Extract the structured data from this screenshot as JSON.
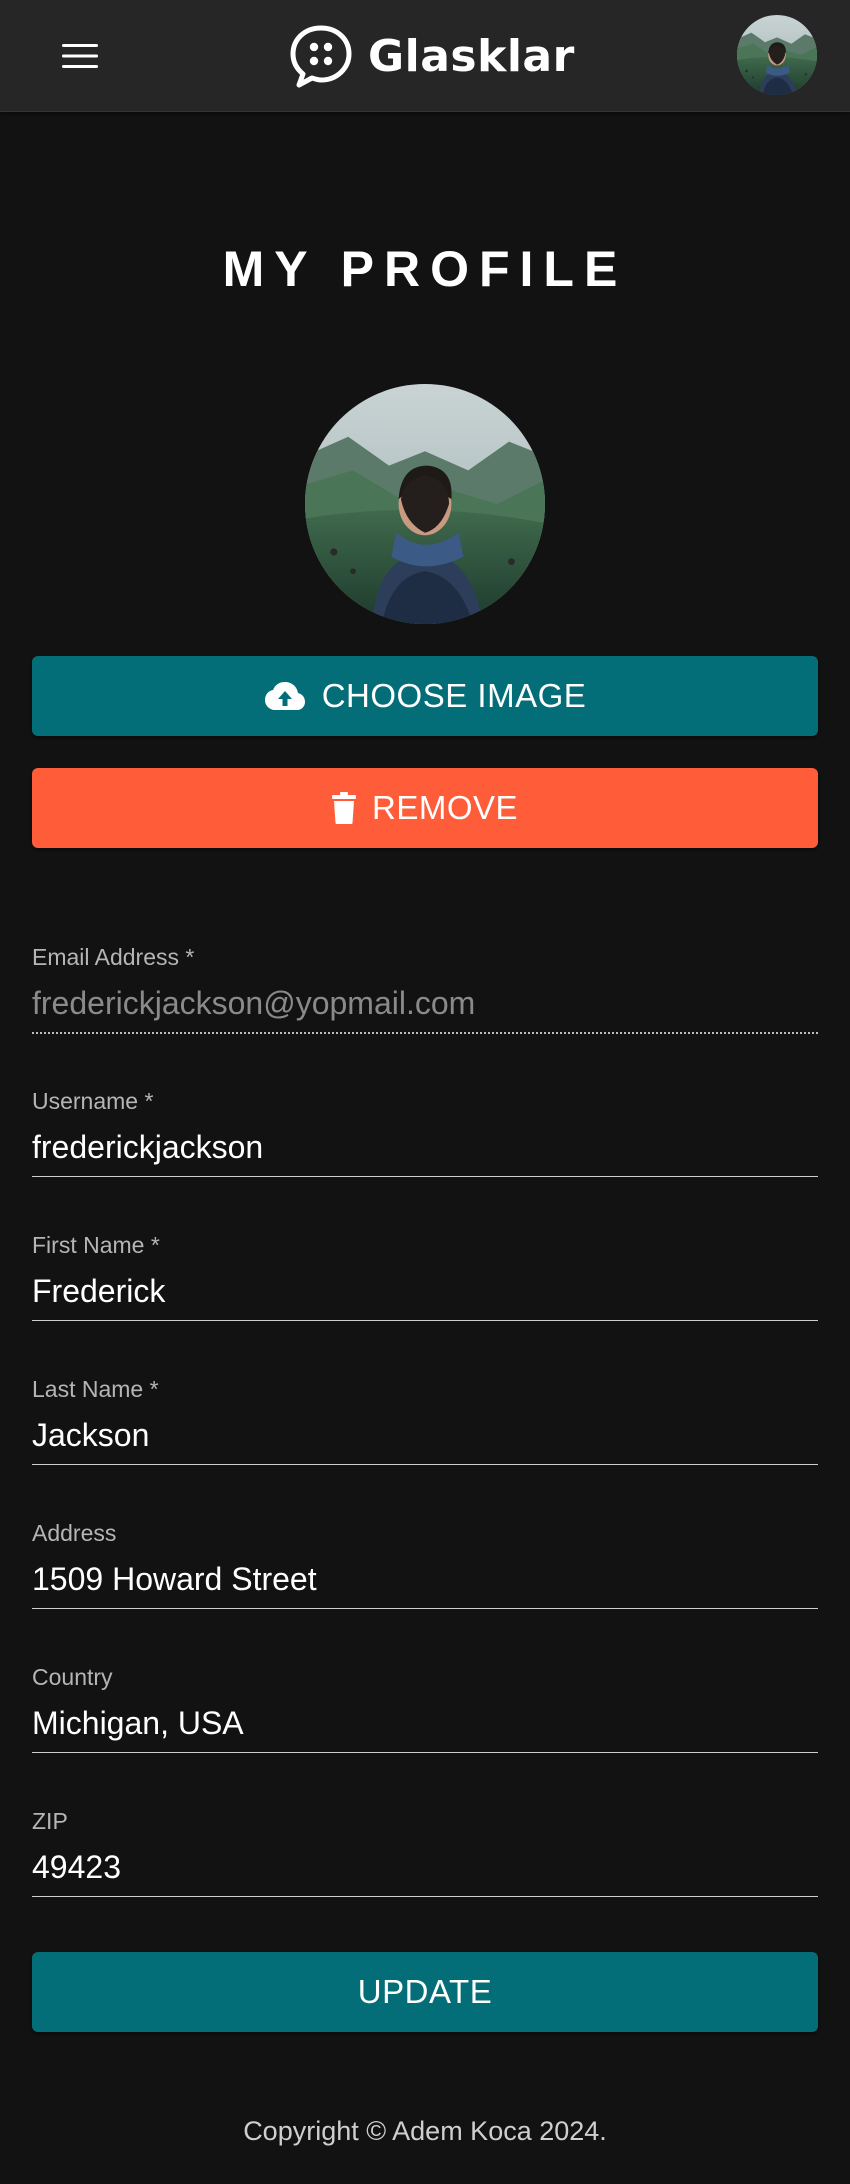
{
  "header": {
    "brand": "Glasklar",
    "menu_icon": "hamburger-menu-icon",
    "logo_icon": "chat-bubble-logo-icon",
    "avatar": "user-avatar-photo"
  },
  "profile": {
    "title": "MY PROFILE",
    "photo": "profile-photo-man-in-green-valley",
    "choose_image_label": "CHOOSE IMAGE",
    "choose_image_icon": "cloud-upload-icon",
    "remove_label": "REMOVE",
    "remove_icon": "trash-icon",
    "remove_color": "#ff5c39",
    "accent_color": "#036e78"
  },
  "form": {
    "email": {
      "label": "Email Address *",
      "value": "frederickjackson@yopmail.com",
      "disabled": true
    },
    "username": {
      "label": "Username *",
      "value": "frederickjackson"
    },
    "first_name": {
      "label": "First Name *",
      "value": "Frederick"
    },
    "last_name": {
      "label": "Last Name *",
      "value": "Jackson"
    },
    "address": {
      "label": "Address",
      "value": "1509 Howard Street"
    },
    "country": {
      "label": "Country",
      "value": "Michigan, USA"
    },
    "zip": {
      "label": "ZIP",
      "value": "49423"
    },
    "submit_label": "UPDATE"
  },
  "footer": {
    "copyright": "Copyright © Adem Koca 2024."
  }
}
